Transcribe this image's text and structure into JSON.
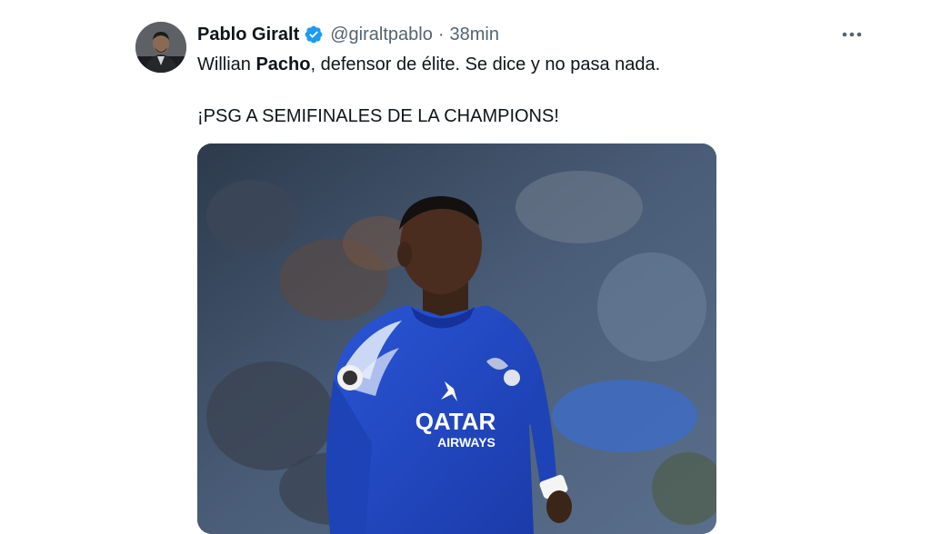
{
  "tweet": {
    "author_name": "Pablo Giralt",
    "handle": "@giraltpablo",
    "separator": "·",
    "time": "38min",
    "verified": true,
    "text_line1_part1": "Willian ",
    "text_line1_bold": "Pacho",
    "text_line1_part2": ", defensor de élite. Se dice y no pasa nada.",
    "text_line2": "¡PSG A SEMIFINALES DE LA CHAMPIONS!",
    "media": {
      "jersey_sponsor_line1": "QATAR",
      "jersey_sponsor_line2": "AIRWAYS"
    }
  },
  "icons": {
    "verified": "verified-badge-icon",
    "more": "more-horizontal-icon"
  },
  "colors": {
    "text": "#0f1419",
    "secondary_text": "#536471",
    "verified_blue": "#1d9bf0",
    "jersey_blue": "#1f47c8"
  }
}
